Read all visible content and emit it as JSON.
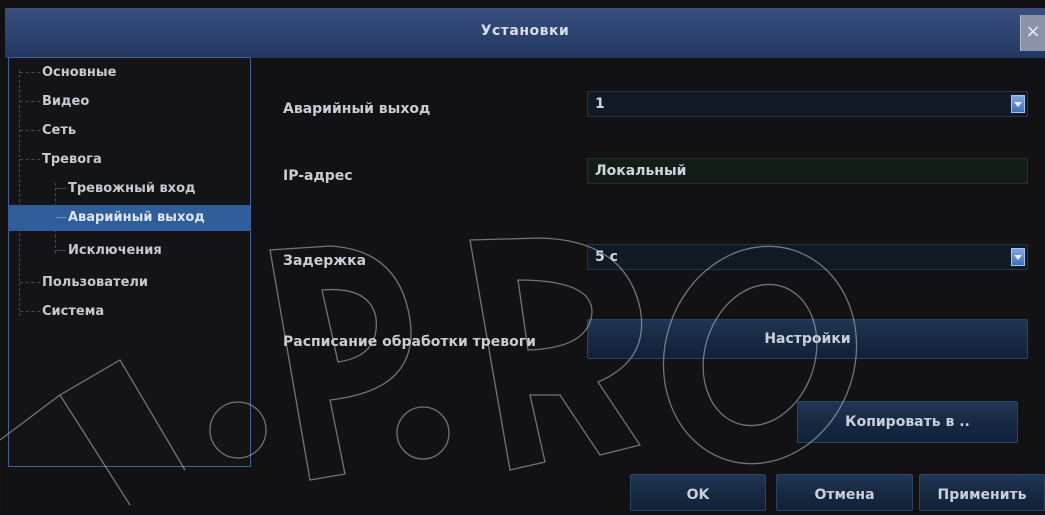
{
  "window": {
    "title": "Установки",
    "close_glyph": "×"
  },
  "sidebar": {
    "items": [
      {
        "label": "Основные"
      },
      {
        "label": "Видео"
      },
      {
        "label": "Сеть"
      },
      {
        "label": "Тревога"
      },
      {
        "label": "Тревожный вход"
      },
      {
        "label": "Аварийный выход",
        "selected": true
      },
      {
        "label": "Исключения"
      },
      {
        "label": "Пользователи"
      },
      {
        "label": "Система"
      }
    ]
  },
  "form": {
    "alarm_output": {
      "label": "Аварийный выход",
      "value": "1"
    },
    "ip_address": {
      "label": "IP-адрес",
      "value": "Локальный"
    },
    "delay": {
      "label": "Задержка",
      "value": "5 с"
    },
    "schedule": {
      "label": "Расписание обработки тревоги",
      "button": "Настройки"
    }
  },
  "buttons": {
    "copy_to": "Копировать в ..",
    "ok": "OK",
    "cancel": "Отмена",
    "apply": "Применить"
  },
  "colors": {
    "title_bar": "#2f4573",
    "selection": "#2f5d9a",
    "sidebar_border": "#3e6494",
    "background": "#121214"
  },
  "icons": {
    "close": "close-icon",
    "dropdown": "chevron-down-icon"
  }
}
